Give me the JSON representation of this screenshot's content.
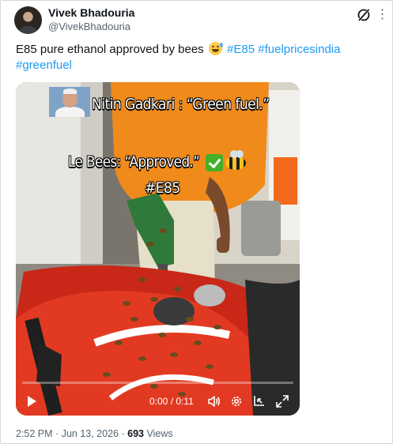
{
  "author": {
    "name": "Vivek Bhadouria",
    "handle": "@VivekBhadouria"
  },
  "header_icons": [
    "grok-icon",
    "more-icon"
  ],
  "tweet": {
    "text": "E85 pure ethanol approved by bees",
    "emoji": "sweat-smile-emoji",
    "hashtags": [
      "#E85",
      "#fuelpricesindia",
      "#greenfuel"
    ]
  },
  "video": {
    "overlay_line1": "Nitin Gadkari : “Green fuel.”",
    "overlay_line2": "Le Bees: “Approved.”",
    "overlay_line3": "#E85",
    "overlay_emojis": [
      "check-mark-emoji",
      "bee-emoji"
    ],
    "time_display": "0:00 / 0:11",
    "progress_fraction": 0.0,
    "controls": [
      "play-icon",
      "volume-icon",
      "settings-icon",
      "pip-icon",
      "fullscreen-icon"
    ]
  },
  "meta": {
    "time": "2:52 PM",
    "date": "Jun 13, 2026",
    "separator": "·",
    "views_count": "693",
    "views_label": "Views"
  },
  "colors": {
    "text": "#0f1419",
    "secondary": "#536471",
    "link": "#1d9bf0",
    "border": "#cfd9de"
  }
}
